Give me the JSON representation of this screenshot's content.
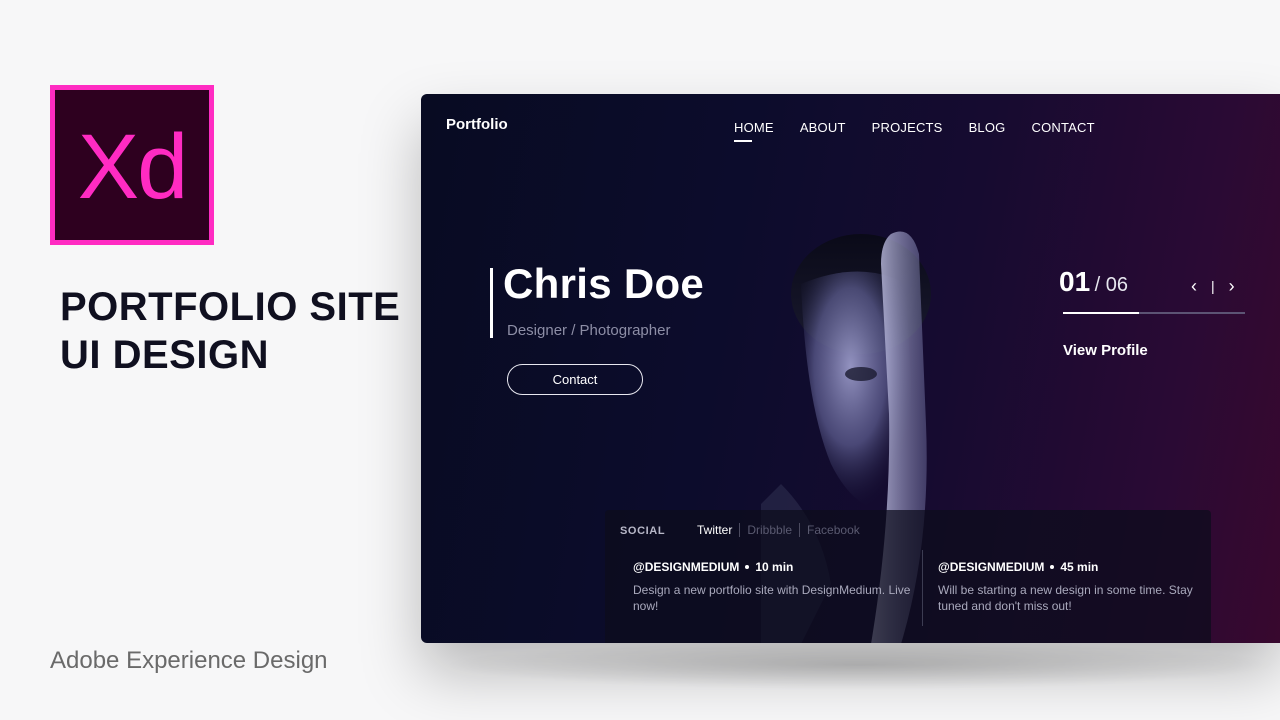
{
  "promo": {
    "logo_text": "Xd",
    "title_line1": "PORTFOLIO SITE",
    "title_line2": "UI DESIGN",
    "footer": "Adobe Experience Design"
  },
  "site": {
    "brand": "Portfolio",
    "nav": [
      "HOME",
      "ABOUT",
      "PROJECTS",
      "BLOG",
      "CONTACT"
    ],
    "active_nav": "HOME",
    "hero": {
      "name": "Chris Doe",
      "role": "Designer / Photographer",
      "button": "Contact"
    },
    "slider": {
      "current": "01",
      "total": "/ 06",
      "progress": 0.42,
      "prev_icon": "chevron-left-icon",
      "next_icon": "chevron-right-icon",
      "view_profile": "View Profile"
    },
    "social": {
      "label": "SOCIAL",
      "tabs": [
        "Twitter",
        "Dribbble",
        "Facebook"
      ],
      "posts": [
        {
          "handle": "@DESIGNMEDIUM",
          "time": "10 min",
          "text": "Design a new portfolio site with DesignMedium. Live now!"
        },
        {
          "handle": "@DESIGNMEDIUM",
          "time": "45 min",
          "text": "Will be starting a new design in some time. Stay tuned and don't miss out!"
        }
      ]
    }
  },
  "colors": {
    "xd_pink": "#ff2bc2",
    "xd_bg": "#2e001f",
    "title": "#101020",
    "site_bg_left": "#080b22",
    "site_bg_right": "#38082e"
  }
}
